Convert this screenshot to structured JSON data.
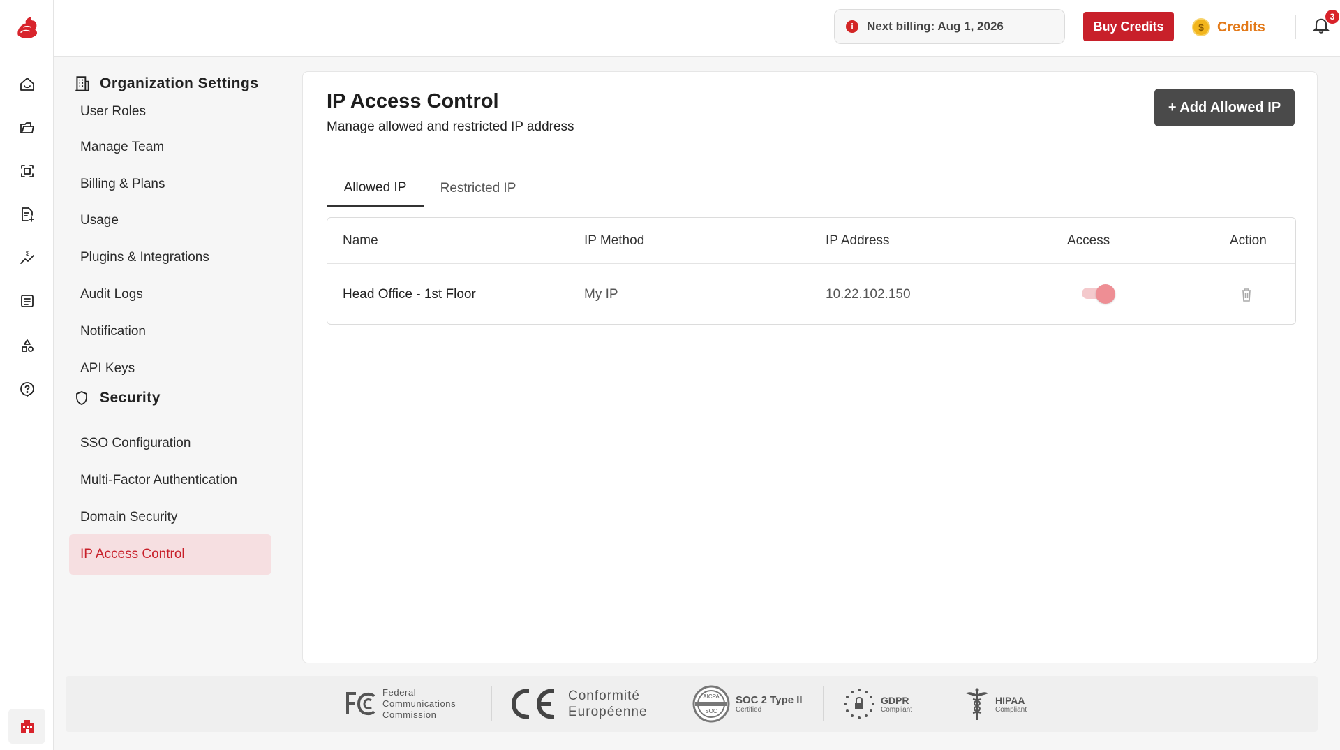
{
  "topbar": {
    "billing_text": "Next billing: Aug 1, 2026",
    "buy_credits_label": "Buy Credits",
    "credits_label": "Credits",
    "coin_symbol": "$",
    "notification_count": "3",
    "info_symbol": "i"
  },
  "rail": {
    "icons": [
      "home-icon",
      "folder-icon",
      "scan-icon",
      "document-add-icon",
      "pricing-trend-icon",
      "list-icon",
      "shapes-icon",
      "help-circle-icon",
      "organization-icon"
    ]
  },
  "sidebar": {
    "title": "Organization Settings",
    "partial_item": "User Roles",
    "items": [
      {
        "label": "Manage Team"
      },
      {
        "label": "Billing & Plans"
      },
      {
        "label": "Usage"
      },
      {
        "label": "Plugins & Integrations"
      },
      {
        "label": "Audit Logs"
      },
      {
        "label": "Notification"
      },
      {
        "label": "API Keys"
      }
    ],
    "security_title": "Security",
    "security_items": [
      {
        "label": "SSO Configuration"
      },
      {
        "label": "Multi-Factor Authentication"
      },
      {
        "label": "Domain Security"
      },
      {
        "label": "IP Access Control",
        "active": true
      }
    ]
  },
  "main": {
    "title": "IP Access Control",
    "subtitle": "Manage allowed and restricted IP address",
    "add_button": "+ Add Allowed IP",
    "tabs": [
      {
        "label": "Allowed IP",
        "active": true
      },
      {
        "label": "Restricted IP",
        "active": false
      }
    ],
    "table": {
      "columns": [
        "Name",
        "IP Method",
        "IP Address",
        "Access",
        "Action"
      ],
      "rows": [
        {
          "name": "Head Office - 1st Floor",
          "method": "My IP",
          "address": "10.22.102.150",
          "access": true
        }
      ]
    }
  },
  "footer": {
    "fcc_lines": [
      "Federal",
      "Communications",
      "Commission"
    ],
    "ce_lines": [
      "Conformité",
      "Européenne"
    ],
    "soc_title": "SOC 2 Type II",
    "soc_sub": "Certified",
    "soc_seal_top": "AICPA",
    "soc_seal_bottom": "SOC",
    "gdpr_title": "GDPR",
    "gdpr_sub": "Compliant",
    "hipaa_title": "HIPAA",
    "hipaa_sub": "Compliant"
  },
  "colors": {
    "brand_red": "#c8202a",
    "active_bg": "#f6dfe1",
    "credits_orange": "#e37a1a",
    "dark_button": "#4a4a4a"
  }
}
